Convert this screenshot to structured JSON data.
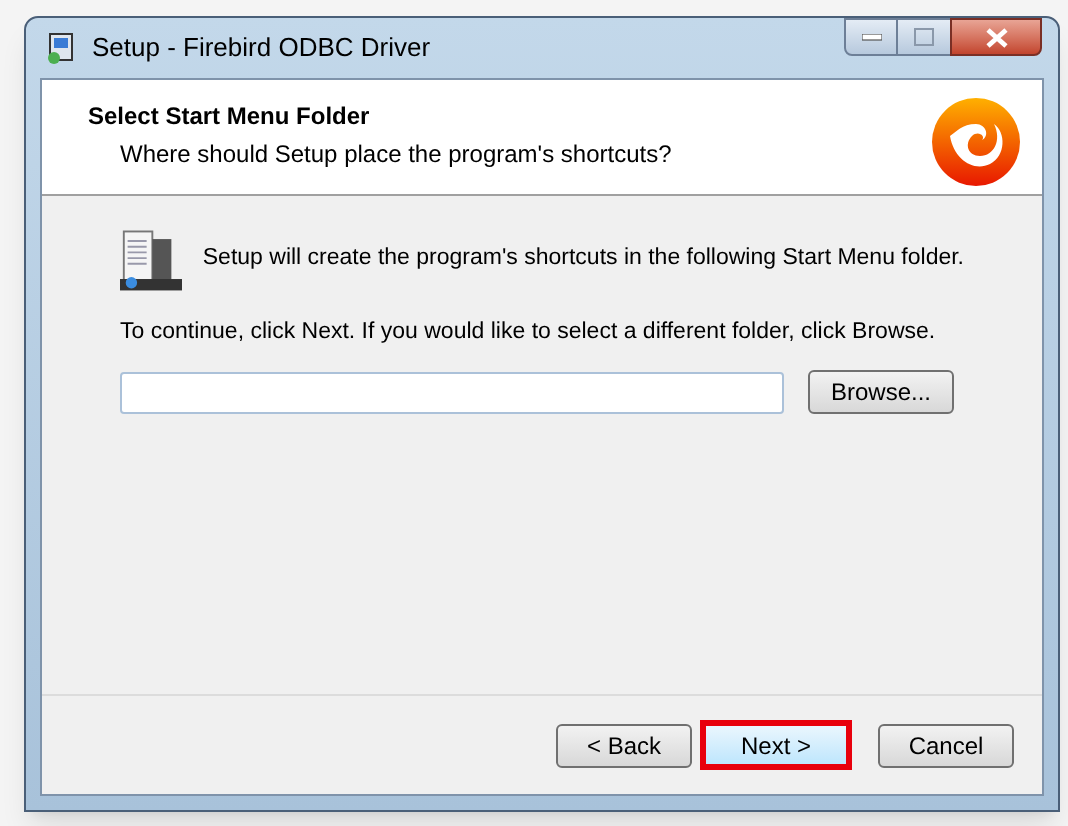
{
  "window": {
    "title": "Setup - Firebird ODBC Driver"
  },
  "header": {
    "title": "Select Start Menu Folder",
    "subtitle": "Where should Setup place the program's shortcuts?"
  },
  "body": {
    "intro": "Setup will create the program's shortcuts in the following Start Menu folder.",
    "instruction": "To continue, click Next. If you would like to select a different folder, click Browse.",
    "browse_button": "Browse..."
  },
  "buttons": [
    {
      "label": "< Back",
      "highlighted": false
    },
    {
      "label": "Next >",
      "highlighted": true
    },
    {
      "label": "Cancel",
      "highlighted": false
    }
  ]
}
